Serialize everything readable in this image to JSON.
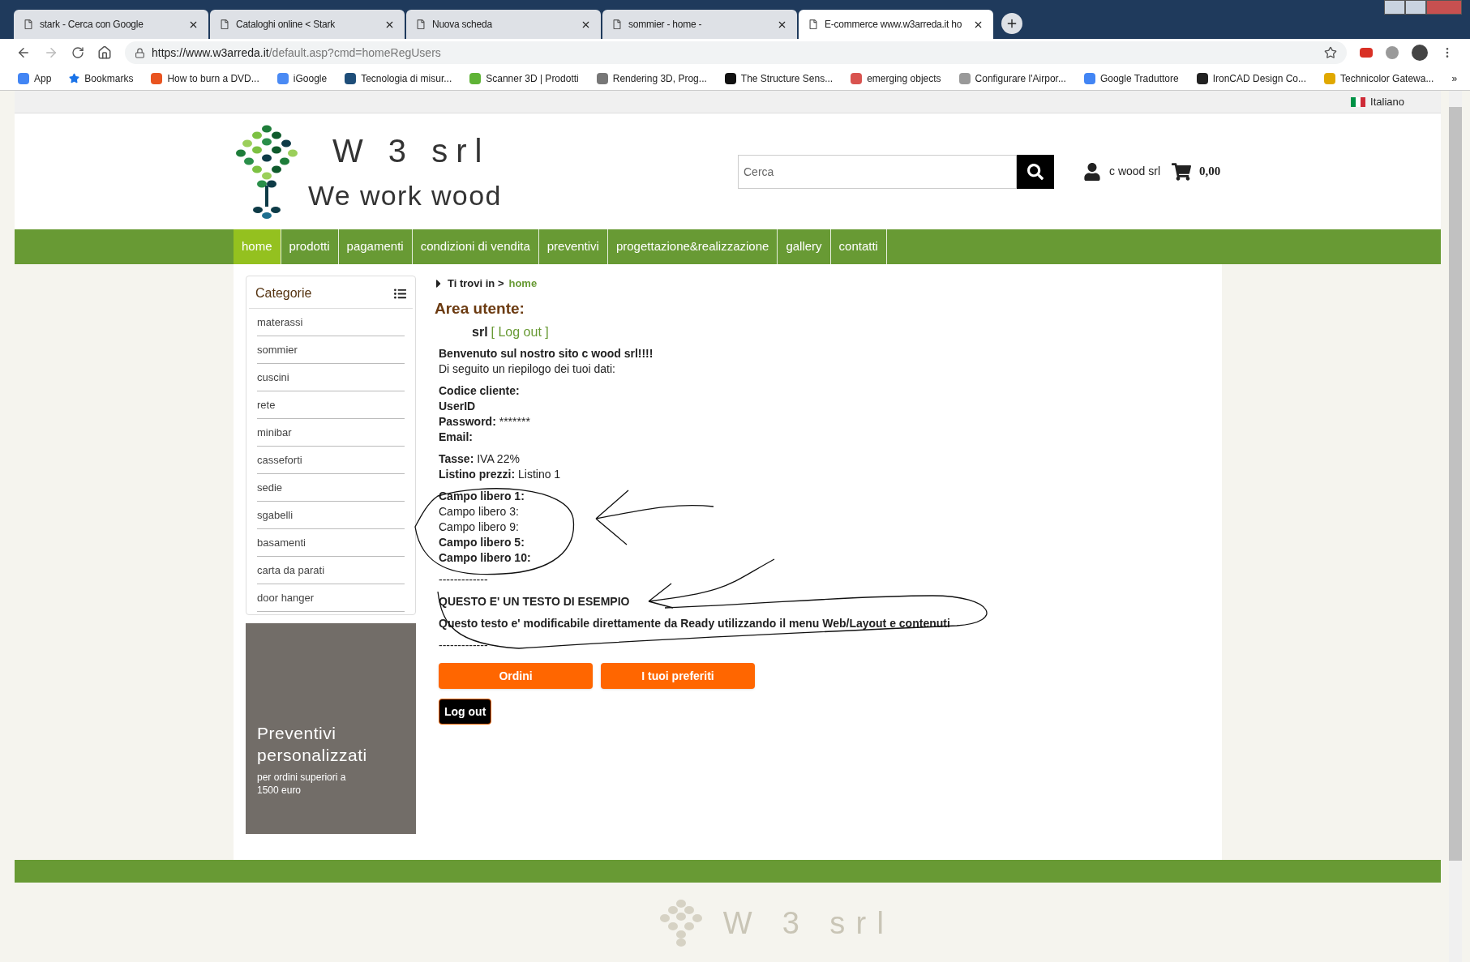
{
  "browser": {
    "tabs": [
      {
        "title": "stark - Cerca con Google",
        "selected": false
      },
      {
        "title": "Cataloghi online < Stark",
        "selected": false
      },
      {
        "title": "Nuova scheda",
        "selected": false
      },
      {
        "title": "sommier - home -",
        "selected": false
      },
      {
        "title": "E-commerce www.w3arreda.it ho",
        "selected": true
      }
    ],
    "address": {
      "host": "https://www.w3arreda.it",
      "path": "/default.asp?cmd=homeRegUsers"
    },
    "bookmarks": [
      "App",
      "Bookmarks",
      "How to burn a DVD...",
      "iGoogle",
      "Tecnologia di misur...",
      "Scanner 3D | Prodotti",
      "Rendering 3D, Prog...",
      "The Structure Sens...",
      "emerging objects",
      "Configurare l'Airpor...",
      "Google Traduttore",
      "IronCAD Design Co...",
      "Technicolor Gatewa..."
    ],
    "bookmarks_more": "»"
  },
  "page": {
    "language": "Italiano",
    "logo": {
      "name": "W 3 srl",
      "tagline": "We work wood"
    },
    "search": {
      "placeholder": "Cerca"
    },
    "user": "c wood srl",
    "cart_total": "0,00",
    "nav": [
      {
        "label": "home",
        "selected": true
      },
      {
        "label": "prodotti",
        "selected": false
      },
      {
        "label": "pagamenti",
        "selected": false
      },
      {
        "label": "condizioni di vendita",
        "selected": false
      },
      {
        "label": "preventivi",
        "selected": false
      },
      {
        "label": "progettazione&realizzazione",
        "selected": false
      },
      {
        "label": "gallery",
        "selected": false
      },
      {
        "label": "contatti",
        "selected": false
      }
    ],
    "sidebar": {
      "title": "Categorie",
      "items": [
        "materassi",
        "sommier",
        "cuscini",
        "rete",
        "minibar",
        "casseforti",
        "sedie",
        "sgabelli",
        "basamenti",
        "carta da parati",
        "door hanger"
      ],
      "banner": {
        "title": "Preventivi personalizzati",
        "subtitle": "per ordini superiori a 1500 euro"
      }
    },
    "breadcrumb": {
      "label": "Ti trovi in >",
      "current": "home"
    },
    "heading": "Area utente:",
    "account": {
      "name": "srl",
      "logout": "[ Log out ]"
    },
    "blocks": [
      [
        {
          "label": "Benvenuto sul nostro sito c wood srl!!!!",
          "bold": true
        },
        {
          "label": "Di seguito un riepilogo dei tuoi dati:",
          "bold": false
        }
      ],
      [
        {
          "label": "Codice cliente:",
          "bold": true
        },
        {
          "label": "UserID",
          "bold": true
        },
        {
          "label": "Password:",
          "bold": true,
          "value": "*******"
        },
        {
          "label": "Email:",
          "bold": true
        }
      ],
      [
        {
          "label": "Tasse:",
          "bold": true,
          "value": "IVA 22%"
        },
        {
          "label": "Listino prezzi:",
          "bold": true,
          "value": "Listino 1"
        }
      ],
      [
        {
          "label": "Campo libero 1:",
          "bold": true
        },
        {
          "label": "Campo libero 3:",
          "bold": false
        },
        {
          "label": "Campo libero 9:",
          "bold": false
        },
        {
          "label": "Campo libero 5:",
          "bold": true
        },
        {
          "label": "Campo libero 10:",
          "bold": true
        }
      ],
      [
        {
          "label": "-------------",
          "bold": false
        }
      ],
      [
        {
          "label": "QUESTO E' UN TESTO DI ESEMPIO",
          "bold": true
        }
      ],
      [
        {
          "label": "Questo testo e' modificabile direttamente da Ready utilizzando il menu Web/Layout e contenuti",
          "bold": true
        }
      ],
      [
        {
          "label": "-------------",
          "bold": false
        }
      ]
    ],
    "buttons": [
      "Ordini",
      "I tuoi preferiti"
    ],
    "logout_button": "Log out",
    "footer_logo": "W 3 srl"
  }
}
